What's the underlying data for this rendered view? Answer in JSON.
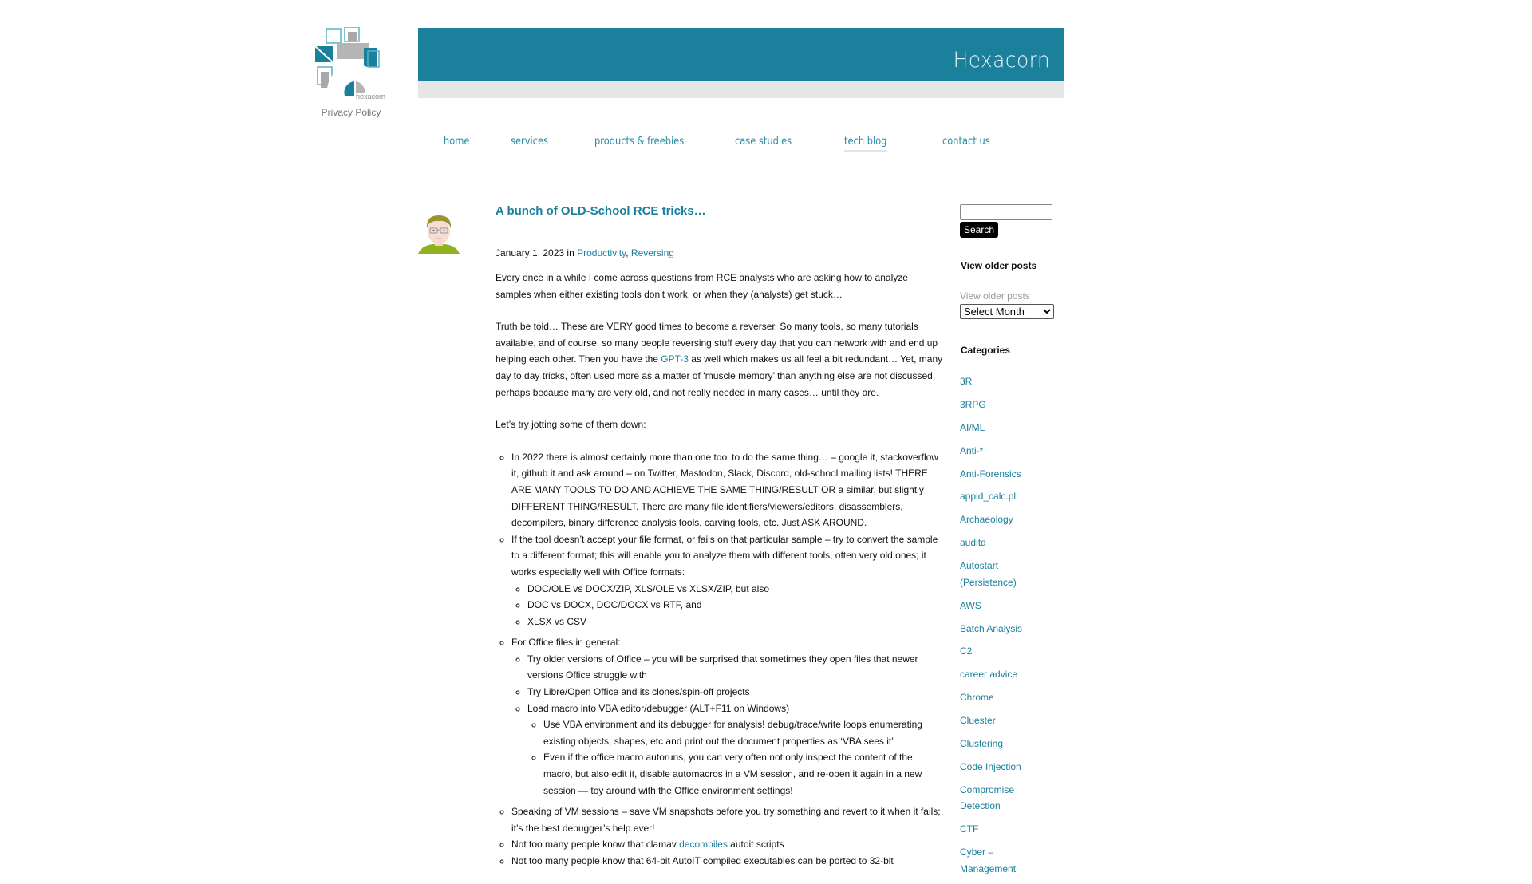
{
  "logo": {
    "alt": "hexacorn logo",
    "wordmark": "hexacorn"
  },
  "privacy_link": "Privacy Policy",
  "header": {
    "brand": "Hexacorn",
    "colors": {
      "band": "#1a809c",
      "strip": "#e6e6e6",
      "link": "#1a7f9c"
    }
  },
  "nav": [
    {
      "label": "home",
      "active": false
    },
    {
      "label": "services",
      "active": false
    },
    {
      "label": "products & freebies",
      "active": false
    },
    {
      "label": "case studies",
      "active": false
    },
    {
      "label": "tech blog",
      "active": true
    },
    {
      "label": "contact us",
      "active": false
    }
  ],
  "post": {
    "title": "A bunch of OLD-School RCE tricks…",
    "date": "January 1, 2023",
    "in_word": "in",
    "categories": [
      "Productivity",
      "Reversing"
    ],
    "p1": "Every once in a while I come across questions from RCE analysts who are asking how to analyze samples when either existing tools don’t work, or when they (analysts) get stuck…",
    "p2_before": "Truth be told… These are VERY good times to become a reverser. So many tools, so many tutorials available, and of course, so many people reversing stuff every day that you can network with and end up helping each other. Then you have the ",
    "p2_link": "GPT-3",
    "p2_after": " as well which makes us all feel a bit redundant… Yet, many day to day tricks, often used more as a matter of ‘muscle memory’ than anything else are not discussed, perhaps because many are very old, and not really needed in many cases… until they are.",
    "p3": "Let’s try jotting some of them down:",
    "list": {
      "item1": "In 2022 there is almost certainly more than one tool to do the same thing… – google it, stackoverflow it, github it and ask around – on Twitter, Mastodon, Slack, Discord, old-school mailing lists! THERE ARE MANY TOOLS TO DO AND ACHIEVE THE SAME THING/RESULT OR a similar, but slightly DIFFERENT THING/RESULT. There are many file identifiers/viewers/editors, disassemblers, decompilers, binary difference analysis tools, carving tools, etc. Just ASK AROUND.",
      "item2": "If the tool doesn’t accept your file format, or fails on that particular sample – try to convert the sample to a different format; this will enable you to analyze them with different tools, often very old ones; it works especially well with Office formats:",
      "item2_sub": [
        "DOC/OLE vs DOCX/ZIP, XLS/OLE vs XLSX/ZIP, but also",
        "DOC vs DOCX, DOC/DOCX vs RTF, and",
        "XLSX vs CSV"
      ],
      "item3": "For Office files in general:",
      "item3_sub1": "Try older versions of Office – you will be surprised that sometimes they open files that newer versions Office struggle with",
      "item3_sub2": "Try Libre/Open Office and its clones/spin-off projects",
      "item3_sub3": "Load macro into VBA editor/debugger (ALT+F11 on Windows)",
      "item3_sub3_sub": [
        "Use VBA environment and its debugger for analysis! debug/trace/write loops enumerating existing objects, shapes, etc and print out the document properties as ‘VBA sees it’",
        "Even if the office macro autoruns, you can very often not only inspect the content of the macro, but also edit it, disable automacros in a VM session, and re-open it again in a new session — toy around with the Office environment settings!"
      ],
      "item4": "Speaking of VM sessions – save VM snapshots before you try something and revert to it when it fails; it’s the best debugger’s help ever!",
      "item5_before": "Not too many people know that clamav ",
      "item5_link": "decompiles",
      "item5_after": " autoit scripts",
      "item6": "Not too many people know that 64-bit AutoIT compiled executables can be ported to 32-bit"
    }
  },
  "sidebar": {
    "search_value": "",
    "search_button": "Search",
    "older_heading": "View older posts",
    "older_label": "View older posts",
    "month_select": "Select Month",
    "categories_heading": "Categories",
    "categories": [
      "3R",
      "3RPG",
      "AI/ML",
      "Anti-*",
      "Anti-Forensics",
      "appid_calc.pl",
      "Archaeology",
      "auditd",
      "Autostart (Persistence)",
      "AWS",
      "Batch Analysis",
      "C2",
      "career advice",
      "Chrome",
      "Cluester",
      "Clustering",
      "Code Injection",
      "Compromise Detection",
      "CTF",
      "Cyber – Management"
    ]
  }
}
